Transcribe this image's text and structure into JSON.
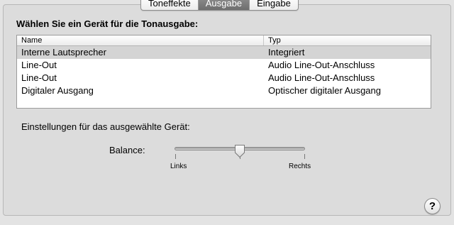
{
  "tabs": [
    {
      "label": "Toneffekte",
      "active": false
    },
    {
      "label": "Ausgabe",
      "active": true
    },
    {
      "label": "Eingabe",
      "active": false
    }
  ],
  "heading": "Wählen Sie ein Gerät für die Tonausgabe:",
  "table": {
    "columns": [
      "Name",
      "Typ"
    ],
    "rows": [
      {
        "name": "Interne Lautsprecher",
        "type": "Integriert",
        "selected": true
      },
      {
        "name": "Line-Out",
        "type": "Audio Line-Out-Anschluss",
        "selected": false
      },
      {
        "name": "Line-Out",
        "type": "Audio Line-Out-Anschluss",
        "selected": false
      },
      {
        "name": "Digitaler Ausgang",
        "type": "Optischer digitaler Ausgang",
        "selected": false
      }
    ]
  },
  "settings_label": "Einstellungen für das ausgewählte Gerät:",
  "balance": {
    "label": "Balance:",
    "min_label": "Links",
    "max_label": "Rechts",
    "value": 0.5
  },
  "help": {
    "label": "?",
    "icon": "help-icon"
  },
  "colors": {
    "panel": "#dcdcdc",
    "selected_row": "#d4d4d4",
    "active_tab": "#7d7d7d"
  }
}
